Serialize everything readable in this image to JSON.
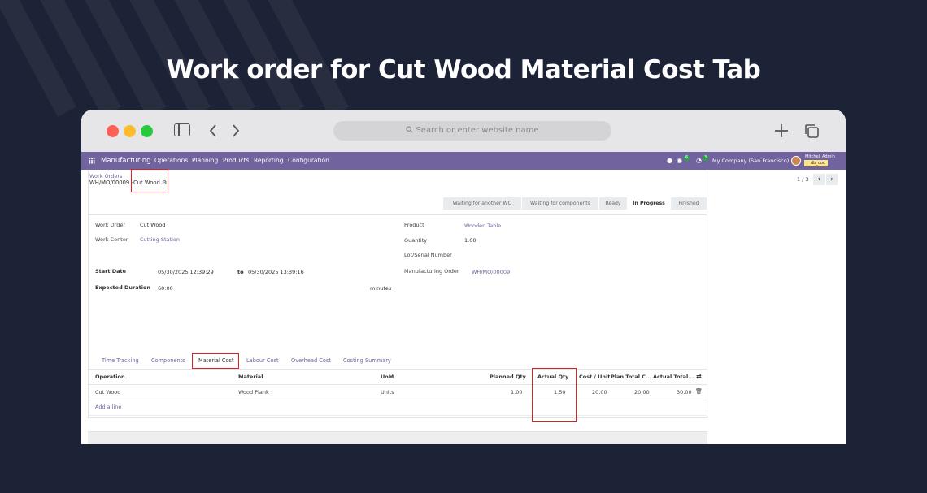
{
  "heading": "Work order for Cut Wood Material Cost Tab",
  "browser": {
    "url_placeholder": "Search or enter website name",
    "icons": [
      "sidebar-icon",
      "back-icon",
      "forward-icon",
      "search-icon",
      "plus-icon",
      "tabs-icon"
    ],
    "colors": {
      "close": "#ff5f57",
      "minimize": "#febc2e",
      "zoom": "#28c840"
    }
  },
  "navbar": {
    "app": "Manufacturing",
    "menus": [
      "Operations",
      "Planning",
      "Products",
      "Reporting",
      "Configuration"
    ],
    "messages_count": "6",
    "activities_count": "3",
    "company": "My Company (San Francisco)",
    "user": "Mitchell Admin",
    "db": "db_doc",
    "accent": "#71639e"
  },
  "breadcrumb": {
    "parent": "Work Orders",
    "path": "WH/MO/00009 - ",
    "current": "Cut Wood"
  },
  "pager": {
    "text": "1 / 3"
  },
  "stages": [
    "Waiting for another WO",
    "Waiting for components",
    "Ready",
    "In Progress",
    "Finished"
  ],
  "active_stage": "In Progress",
  "form": {
    "work_order_label": "Work Order",
    "work_order": "Cut Wood",
    "work_center_label": "Work Center",
    "work_center": "Cutting Station",
    "start_date_label": "Start Date",
    "start_date": "05/30/2025 12:39:29",
    "to_label": "to",
    "end_date": "05/30/2025 13:39:16",
    "expected_duration_label": "Expected Duration",
    "expected_duration": "60:00",
    "duration_unit": "minutes",
    "product_label": "Product",
    "product": "Wooden Table",
    "quantity_label": "Quantity",
    "quantity": "1.00",
    "lot_label": "Lot/Serial Number",
    "mo_label": "Manufacturing Order",
    "mo": "WH/MO/00009"
  },
  "tabs": [
    "Time Tracking",
    "Components",
    "Material Cost",
    "Labour Cost",
    "Overhead Cost",
    "Costing Summary"
  ],
  "active_tab": "Material Cost",
  "table": {
    "headers": [
      "Operation",
      "Material",
      "UoM",
      "Planned Qty",
      "Actual Qty",
      "Cost / Unit",
      "Plan Total C...",
      "Actual Total..."
    ],
    "rows": [
      [
        "Cut Wood",
        "Wood Plank",
        "Units",
        "1.00",
        "1.50",
        "20.00",
        "20.00",
        "30.00"
      ]
    ],
    "add_line": "Add a line"
  }
}
